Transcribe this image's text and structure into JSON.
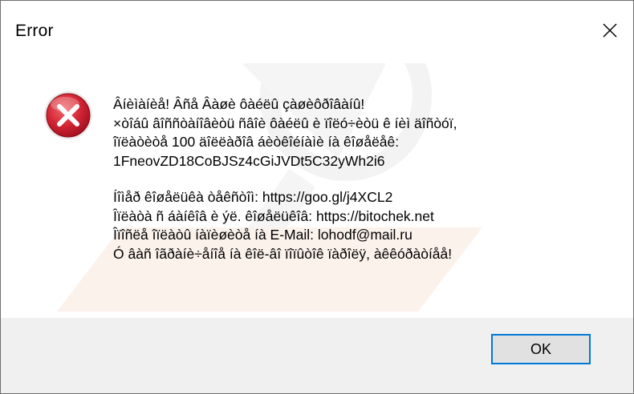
{
  "window": {
    "title": "Error",
    "close_icon": "close-icon"
  },
  "dialog": {
    "icon": "error-icon",
    "message_lines_1": [
      "Âíèìàíèå! Âñå Âàøè ôàéëû çàøèôðîâàíû!",
      "×òîáû âîññòàíîâèòü ñâîè ôàéëû è ïîëó÷èòü ê íèì äîñòóï,",
      "îïëàòèòå 100 äîëëàðîâ áèòêîéíàìè íà êîøåëåê:",
      "1FneovZD18CoBJSz4cGiJVDt5C32yWh2i6"
    ],
    "message_lines_2": [
      "Íîìåð êîøåëüêà òåêñòîì: https://goo.gl/j4XCL2",
      "Îïëàòà ñ áàíêîâ è ýë. êîøåëüêîâ: https://bitochek.net",
      "Îïîñëå îïëàòû íàïèøèòå íà E-Mail: lohodf@mail.ru",
      "Ó âàñ îãðàíè÷åíîå íà êîë-âî ïîïûòîê ïàðîëÿ, àêêóðàòíåå!"
    ],
    "ok_label": "OK"
  },
  "colors": {
    "accent": "#0078d7",
    "footer_bg": "#f0f0f0",
    "error_red": "#c8182a"
  }
}
